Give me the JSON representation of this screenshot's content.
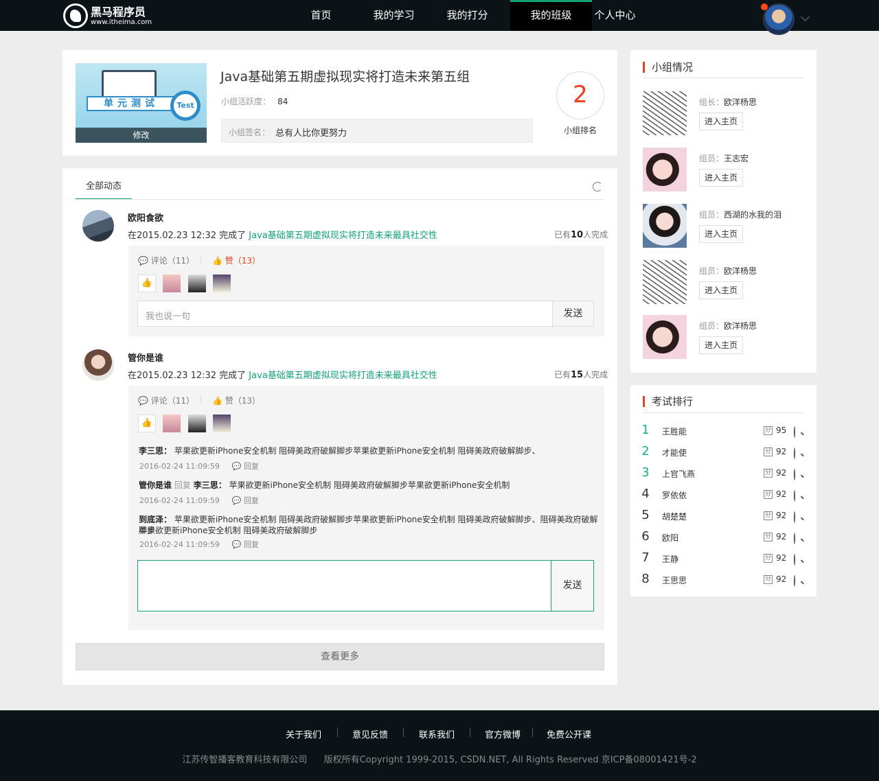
{
  "header": {
    "logo_title": "黑马程序员",
    "logo_url": "www.itheima.com",
    "nav": [
      "首页",
      "我的学习",
      "我的打分",
      "我的班级",
      "个人中心"
    ],
    "active_nav": "我的班级"
  },
  "group": {
    "thumb_banner": "单元测试",
    "thumb_badge": "Test",
    "edit_label": "修改",
    "title": "Java基础第五期虚拟现实将打造未来第五组",
    "activity_label": "小组活跃度：",
    "activity_value": "84",
    "sign_label": "小组签名：",
    "sign_value": "总有人比你更努力",
    "rank_value": "2",
    "rank_label": "小组排名"
  },
  "feed": {
    "tab": "全部动态",
    "posts": [
      {
        "name": "欧阳食欲",
        "prefix": "在2015.02.23 12:32 完成了 ",
        "link": "Java基础第五期虚拟现实将打造未来最具社交性",
        "done_pre": "已有",
        "done_num": "10",
        "done_post": "人完成",
        "comment": "评论（11）",
        "like": "赞（13）",
        "input_placeholder": "我也说一句",
        "send": "发送"
      },
      {
        "name": "管你是谁",
        "prefix": "在2015.02.23 12:32 完成了 ",
        "link": "Java基础第五期虚拟现实将打造未来最具社交性",
        "done_pre": "已有",
        "done_num": "15",
        "done_post": "人完成",
        "comment": "评论（11）",
        "like": "赞（13）",
        "replies": [
          {
            "author": "李三思：",
            "text": "苹果欲更新iPhone安全机制 阻碍美政府破解脚步苹果欲更新iPhone安全机制 阻碍美政府破解脚步、",
            "time": "2016-02-24 11:09:59",
            "reply": "回复"
          },
          {
            "author": "管你是谁",
            "mid": "回复",
            "target": "李三思：",
            "text": "苹果欲更新iPhone安全机制 阻碍美政府破解脚步苹果欲更新iPhone安全机制",
            "time": "2016-02-24 11:09:59",
            "reply": "回复"
          },
          {
            "author": "到底泽：",
            "text": "苹果欲更新iPhone安全机制 阻碍美政府破解脚步苹果欲更新iPhone安全机制 阻碍美政府破解脚步、阻碍美政府破解脚步",
            "text2": "苹果欲更新iPhone安全机制 阻碍美政府破解脚步",
            "time": "2016-02-24 11:09:59",
            "reply": "回复"
          }
        ],
        "send": "发送"
      }
    ],
    "more": "查看更多"
  },
  "sidebar": {
    "group_title": "小组情况",
    "members": [
      {
        "role": "组长：",
        "name": "欧洋杨思",
        "btn": "进入主页"
      },
      {
        "role": "组员：",
        "name": "王志宏",
        "btn": "进入主页"
      },
      {
        "role": "组员：",
        "name": "西湖的水我的泪",
        "btn": "进入主页"
      },
      {
        "role": "组员：",
        "name": "欧洋杨思",
        "btn": "进入主页"
      },
      {
        "role": "组员：",
        "name": "欧洋杨思",
        "btn": "进入主页"
      }
    ],
    "rank_title": "考试排行",
    "fen": "分",
    "ranks": [
      {
        "no": "1",
        "name": "王胜能",
        "score": "95"
      },
      {
        "no": "2",
        "name": "才能使",
        "score": "92"
      },
      {
        "no": "3",
        "name": "上官飞燕",
        "score": "92"
      },
      {
        "no": "4",
        "name": "罗依依",
        "score": "92"
      },
      {
        "no": "5",
        "name": "胡楚楚",
        "score": "92"
      },
      {
        "no": "6",
        "name": "欧阳",
        "score": "92"
      },
      {
        "no": "7",
        "name": "王静",
        "score": "92"
      },
      {
        "no": "8",
        "name": "王思思",
        "score": "92"
      }
    ]
  },
  "footer": {
    "links": [
      "关于我们",
      "意见反馈",
      "联系我们",
      "官方微博",
      "免费公开课"
    ],
    "company": "江苏传智播客教育科技有限公司",
    "copyright": "版权所有Copyright 1999-2015, CSDN.NET, All Rights Reserved 京ICP备08001421号-2"
  },
  "colors": {
    "accent": "#14a077",
    "brand_red": "#e8401c",
    "header_bg": "#0c1316"
  }
}
